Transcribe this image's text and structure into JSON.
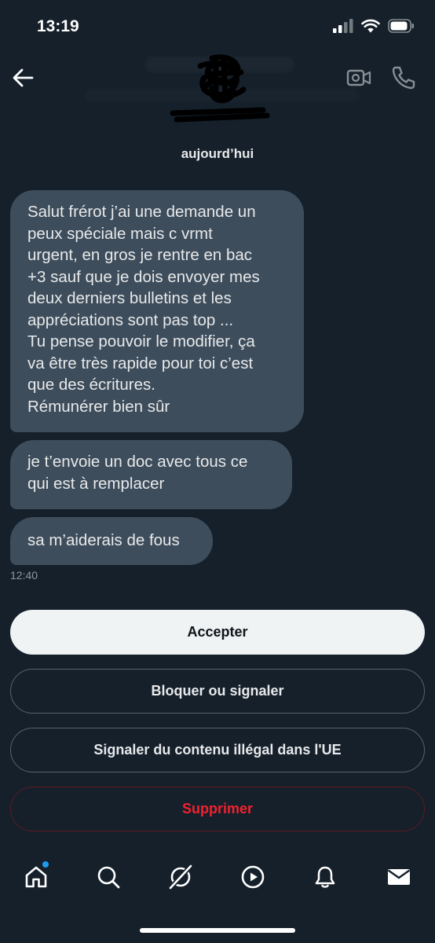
{
  "status_bar": {
    "time": "13:19"
  },
  "header": {
    "back_icon": "arrow-left-icon",
    "video_icon": "video-call-icon",
    "phone_icon": "phone-icon"
  },
  "conversation": {
    "day_label": "aujourd’hui",
    "messages": [
      {
        "text": "Salut frérot j’ai une demande un\npeux spéciale mais c vrmt\nurgent, en gros je rentre en bac\n+3 sauf que je dois envoyer mes\ndeux derniers bulletins et les\nappréciations sont pas top ...\nTu pense pouvoir le modifier, ça\nva être très rapide pour toi c’est\nque des écritures.\nRémunérer bien sûr"
      },
      {
        "text": "je t’envoie un doc avec tous ce\nqui est à remplacer"
      },
      {
        "text": "sa m’aiderais de fous"
      }
    ],
    "last_time": "12:40"
  },
  "actions": {
    "accept": "Accepter",
    "block": "Bloquer ou signaler",
    "report_eu": "Signaler du contenu illégal dans l'UE",
    "delete": "Supprimer"
  },
  "nav": {
    "items": [
      "home-icon",
      "search-icon",
      "grok-icon",
      "play-icon",
      "bell-icon",
      "mail-icon"
    ]
  },
  "colors": {
    "background": "#15202b",
    "bubble": "#3e4d5c",
    "danger": "#f4212e",
    "accent": "#1d9bf0"
  }
}
